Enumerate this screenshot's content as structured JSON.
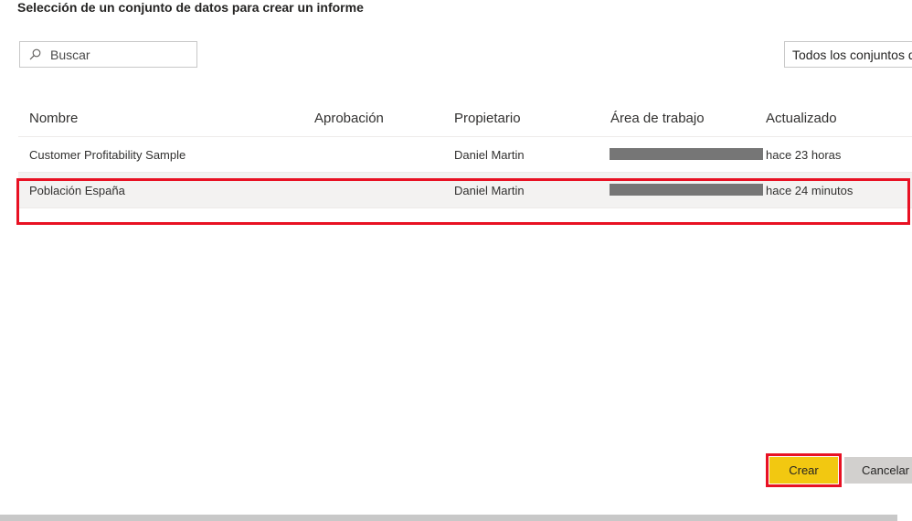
{
  "dialog": {
    "title": "Selección de un conjunto de datos para crear un informe"
  },
  "search": {
    "placeholder": "Buscar",
    "value": "",
    "icon": "search-icon"
  },
  "filter": {
    "selected": "Todos los conjuntos de datos"
  },
  "table": {
    "columns": [
      "Nombre",
      "Aprobación",
      "Propietario",
      "Área de trabajo",
      "Actualizado"
    ],
    "rows": [
      {
        "name": "Customer Profitability Sample",
        "approval": "",
        "owner": "Daniel Martin",
        "workspace": "",
        "updated": "hace 23 horas",
        "selected": false
      },
      {
        "name": "Población España",
        "approval": "",
        "owner": "Daniel Martin",
        "workspace": "",
        "updated": "hace 24 minutos",
        "selected": true
      }
    ]
  },
  "actions": {
    "create_label": "Crear",
    "cancel_label": "Cancelar"
  },
  "colors": {
    "accent": "#f2c811",
    "highlight": "#e81123",
    "redaction": "#767676",
    "selected_row": "#f3f2f1",
    "secondary_button": "#d2d0ce"
  }
}
